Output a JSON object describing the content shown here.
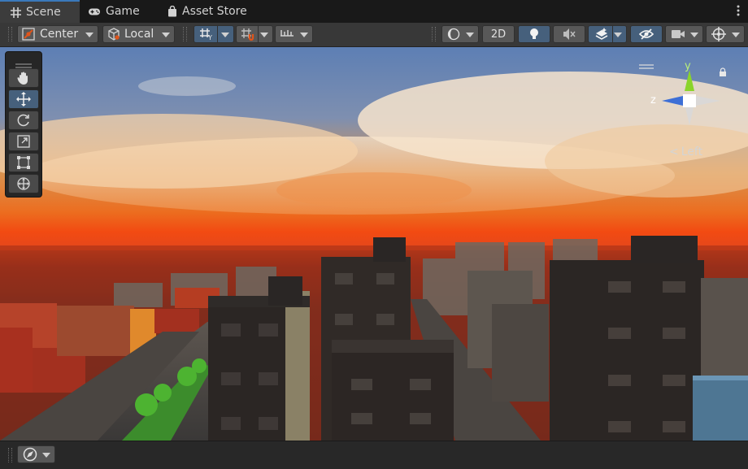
{
  "tabs": [
    {
      "label": "Scene",
      "icon": "grid-hash-icon",
      "active": true
    },
    {
      "label": "Game",
      "icon": "gamepad-icon",
      "active": false
    },
    {
      "label": "Asset Store",
      "icon": "shopping-bag-icon",
      "active": false
    }
  ],
  "toolbar": {
    "pivot_mode": "Center",
    "pivot_rotation": "Local",
    "mode_2d": "2D"
  },
  "gizmo": {
    "y_axis": "y",
    "z_axis": "z",
    "view_label": "Left",
    "view_prefix": "<"
  },
  "colors": {
    "accent": "#46607c",
    "tab_highlight": "#3a79bb",
    "gizmo_y": "#8ad42a",
    "gizmo_z": "#3d6fd6"
  }
}
